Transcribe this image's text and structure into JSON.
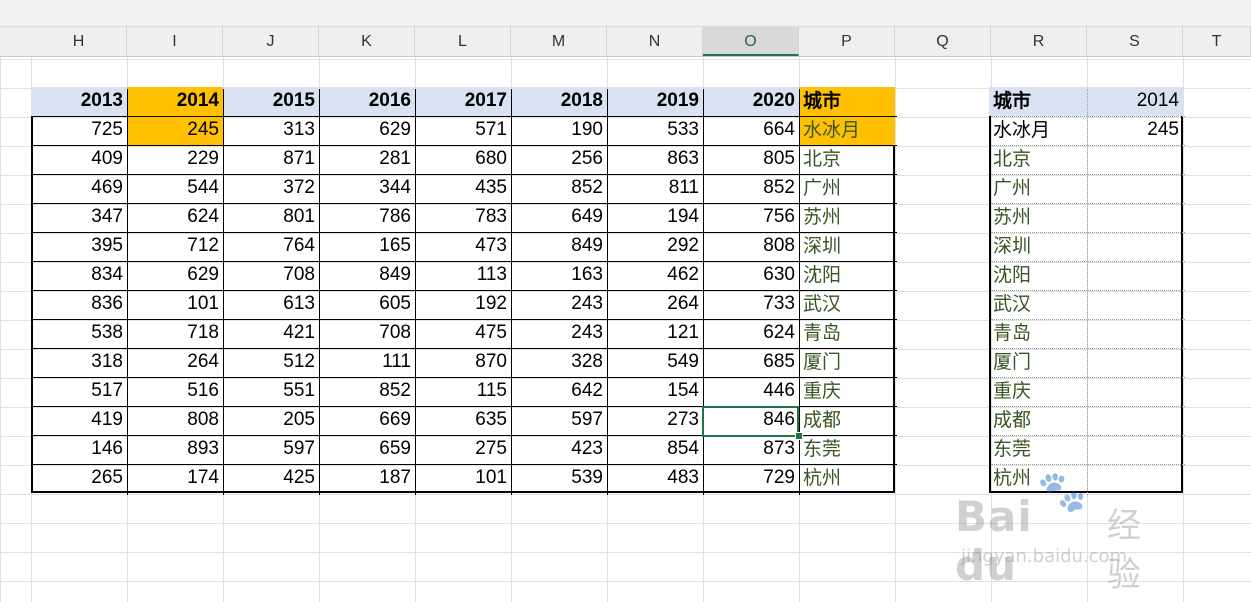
{
  "columns": [
    "H",
    "I",
    "J",
    "K",
    "L",
    "M",
    "N",
    "O",
    "P",
    "Q",
    "R",
    "S",
    "T"
  ],
  "selected_column": "O",
  "main_table": {
    "headers": [
      "2013",
      "2014",
      "2015",
      "2016",
      "2017",
      "2018",
      "2019",
      "2020",
      "城市"
    ],
    "rows": [
      [
        "725",
        "245",
        "313",
        "629",
        "571",
        "190",
        "533",
        "664",
        "水冰月"
      ],
      [
        "409",
        "229",
        "871",
        "281",
        "680",
        "256",
        "863",
        "805",
        "北京"
      ],
      [
        "469",
        "544",
        "372",
        "344",
        "435",
        "852",
        "811",
        "852",
        "广州"
      ],
      [
        "347",
        "624",
        "801",
        "786",
        "783",
        "649",
        "194",
        "756",
        "苏州"
      ],
      [
        "395",
        "712",
        "764",
        "165",
        "473",
        "849",
        "292",
        "808",
        "深圳"
      ],
      [
        "834",
        "629",
        "708",
        "849",
        "113",
        "163",
        "462",
        "630",
        "沈阳"
      ],
      [
        "836",
        "101",
        "613",
        "605",
        "192",
        "243",
        "264",
        "733",
        "武汉"
      ],
      [
        "538",
        "718",
        "421",
        "708",
        "475",
        "243",
        "121",
        "624",
        "青岛"
      ],
      [
        "318",
        "264",
        "512",
        "111",
        "870",
        "328",
        "549",
        "685",
        "厦门"
      ],
      [
        "517",
        "516",
        "551",
        "852",
        "115",
        "642",
        "154",
        "446",
        "重庆"
      ],
      [
        "419",
        "808",
        "205",
        "669",
        "635",
        "597",
        "273",
        "846",
        "成都"
      ],
      [
        "146",
        "893",
        "597",
        "659",
        "275",
        "423",
        "854",
        "873",
        "东莞"
      ],
      [
        "265",
        "174",
        "425",
        "187",
        "101",
        "539",
        "483",
        "729",
        "杭州"
      ]
    ]
  },
  "right_table": {
    "header_city": "城市",
    "header_year": "2014",
    "first_value": "245",
    "cities": [
      "水冰月",
      "北京",
      "广州",
      "苏州",
      "深圳",
      "沈阳",
      "武汉",
      "青岛",
      "厦门",
      "重庆",
      "成都",
      "东莞",
      "杭州"
    ]
  },
  "watermark": {
    "logo": "Bai  du",
    "logo_sub": "经验",
    "url": "jingyan.baidu.com"
  },
  "colors": {
    "header_fill": "#d9e1f2",
    "highlight": "#ffc000",
    "selection": "#217346",
    "city_text": "#375623"
  }
}
